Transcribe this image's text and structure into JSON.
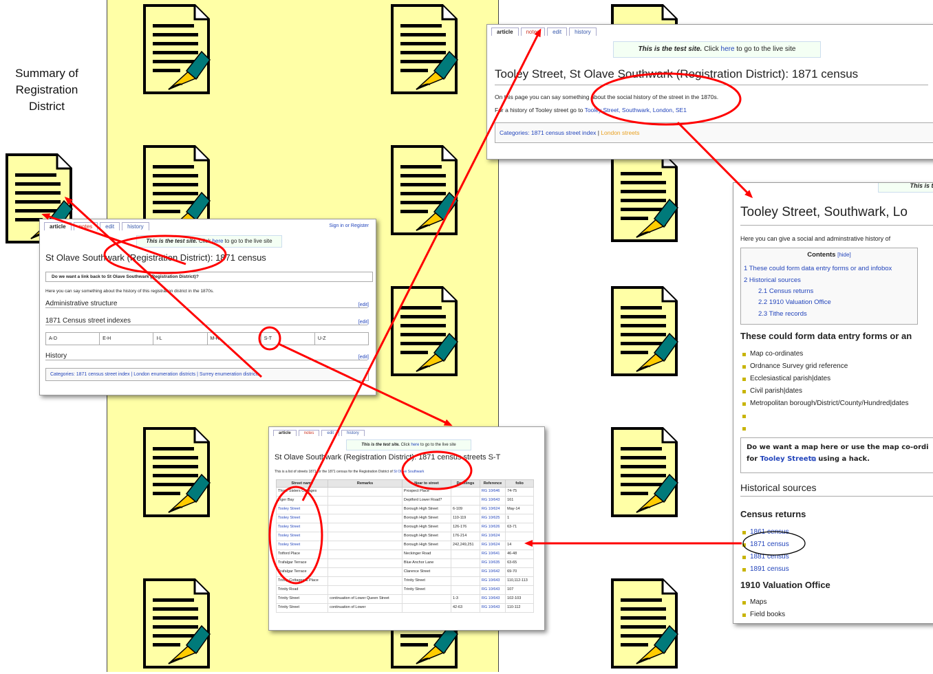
{
  "summary_label": "Summary of Registration District",
  "colors": {
    "band": "#ffffa6",
    "arrow": "#ff0000",
    "link": "#2244bb"
  },
  "tabs": {
    "article": "article",
    "notes": "notes",
    "edit": "edit",
    "history": "history"
  },
  "banner": {
    "italic": "This is the test site.",
    "pre": " Click ",
    "here": "here",
    "post": " to go to the live site"
  },
  "registration_page": {
    "top_right": "Sign in or Register",
    "title": "St Olave Southwark (Registration District): 1871 census",
    "link_question": "Do we want a link back to St Olave Southwark (Registration District)?",
    "intro": "Here you can say something about the history of this registration district in the 1870s.",
    "sections": {
      "admin": "Administrative structure",
      "indexes": "1871 Census street indexes",
      "history": "History"
    },
    "edit_label": "[edit]",
    "index_cells": [
      "A-D",
      "E-H",
      "I-L",
      "M-R",
      "S-T",
      "U-Z"
    ],
    "categories": "Categories: 1871 census street index | London enumeration districts | Surrey enumeration districts"
  },
  "census_page": {
    "title": "St Olave Southwark (Registration District): 1871 census streets S-T",
    "intro_pre": "This is a list of streets 1871 for the 1871 census for the Registration District of ",
    "intro_link": "St Olave Southwark",
    "headers": [
      "Street name",
      "Remarks",
      "Near to street",
      "Dwellings",
      "Reference",
      "folio"
    ],
    "rows": [
      [
        "Three Sisters Cottages",
        "",
        "Prospect Place",
        "",
        "RG 10/646",
        "74-75"
      ],
      [
        "Tiger Bay",
        "",
        "Deptford Lower Road?",
        "",
        "RG 10/643",
        "161"
      ],
      [
        "Tooley Street",
        "",
        "Borough High Street",
        "6-109",
        "RG 10/624",
        "May-14"
      ],
      [
        "Tooley Street",
        "",
        "Borough High Street",
        "110-119",
        "RG 10/625",
        "1"
      ],
      [
        "Tooley Street",
        "",
        "Borough High Street",
        "126-176",
        "RG 10/626",
        "63-71"
      ],
      [
        "Tooley Street",
        "",
        "Borough High Street",
        "176-214",
        "RG 10/624",
        ""
      ],
      [
        "Tooley Street",
        "",
        "Borough High Street",
        "242,249,251",
        "RG 10/624",
        "14"
      ],
      [
        "Totford Place",
        "",
        "Neckinger Road",
        "",
        "RG 10/641",
        "46-48"
      ],
      [
        "Trafalgar Terrace",
        "",
        "Blue Anchor Lane",
        "",
        "RG 10/635",
        "63-65"
      ],
      [
        "Trafalgar Terrace",
        "",
        "Clarence Street",
        "",
        "RG 10/642",
        "69-70"
      ],
      [
        "Trinity Cottages & Place",
        "",
        "Trinity Street",
        "",
        "RG 10/643",
        "110,112-113"
      ],
      [
        "Trinity Road",
        "",
        "Trinity Street",
        "",
        "RG 10/643",
        "107"
      ],
      [
        "Trinity Street",
        "continuation of Lower Queen Street",
        "",
        "1-3",
        "RG 10/643",
        "102-103"
      ],
      [
        "Trinity Street",
        "continuation of Lower",
        "",
        "42-63",
        "RG 10/643",
        "110-112"
      ]
    ]
  },
  "street_census_page": {
    "title": "Tooley Street, St Olave Southwark (Registration District): 1871 census",
    "line1": "On this page you can say something about the social history of the street in the 1870s.",
    "line2_pre": "For a history of Tooley street go to ",
    "line2_link": "Tooley Street, Southwark, London, SE1",
    "cats_pre": "Categories: ",
    "cats_link1": "1871 census street index",
    "cats_sep": " | ",
    "cats_link2": "London streets"
  },
  "street_page": {
    "banner_clip": "This is the",
    "title": "Tooley Street, Southwark, Lo",
    "intro": "Here you can give a social and adminstrative history of",
    "toc_title": "Contents",
    "toc_hide": "[hide]",
    "toc": [
      "1 These could form data entry forms or and infobox",
      "2 Historical sources",
      "2.1 Census returns",
      "2.2 1910 Valuation Office",
      "2.3 Tithe records"
    ],
    "h_forms": "These could form data entry forms or an",
    "bullets": [
      "Map co-ordinates",
      "Ordnance Survey grid reference",
      "Ecclesiastical parish|dates",
      "Civil parish|dates",
      "Metropolitan borough/District/County/Hundred|dates",
      "",
      ""
    ],
    "map_q1": "Do we want a map here or use the map co-ordi",
    "map_q2_pre": "for ",
    "map_q2_link": "Tooley Street",
    "map_q2_post": " using a hack.",
    "h_sources": "Historical sources",
    "h_census": "Census returns",
    "census_list": [
      "1861 census",
      "1871 census",
      "1881 census",
      "1891 census"
    ],
    "h_valuation": "1910 Valuation Office",
    "valuation_list": [
      "Maps",
      "Field books"
    ]
  }
}
